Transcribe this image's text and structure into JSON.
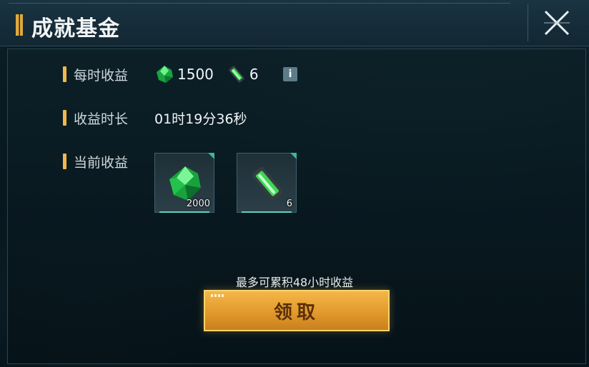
{
  "title": "成就基金",
  "rows": {
    "hourly_label": "每时收益",
    "hourly_gem": "1500",
    "hourly_crystal": "6",
    "duration_label": "收益时长",
    "duration_value": "01时19分36秒",
    "current_label": "当前收益"
  },
  "rewards": [
    {
      "icon": "green-gem-icon",
      "qty": "2000"
    },
    {
      "icon": "green-crystal-icon",
      "qty": "6"
    }
  ],
  "hint": "最多可累积48小时收益",
  "claim_label": "领取",
  "info_label": "i",
  "colors": {
    "accent": "#f3b84a",
    "button": "#e29a2c",
    "gem": "#2fd35a"
  }
}
